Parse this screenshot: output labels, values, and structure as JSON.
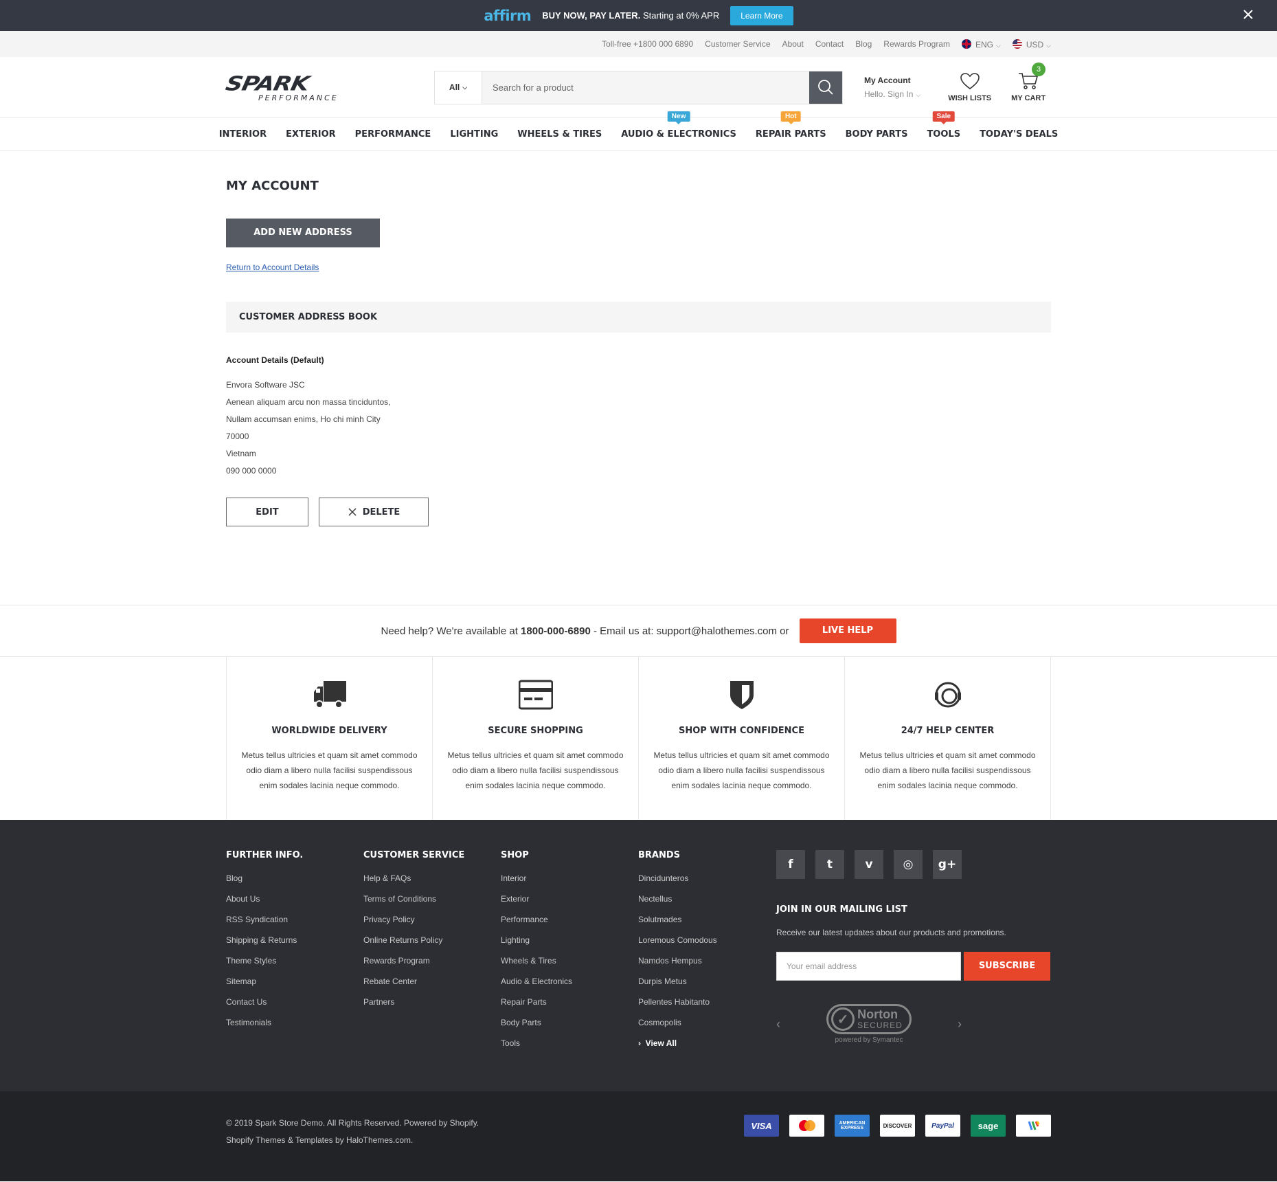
{
  "promo": {
    "brand": "affirm",
    "headline": "BUY NOW, PAY LATER.",
    "subtext": "Starting at 0% APR",
    "button": "Learn More",
    "close_icon": "close-icon"
  },
  "topbar": {
    "phone": "Toll-free +1800 000 6890",
    "links": [
      "Customer Service",
      "About",
      "Contact",
      "Blog",
      "Rewards Program"
    ],
    "language": "ENG",
    "currency": "USD"
  },
  "header": {
    "logo_main": "SPARK",
    "logo_sub": "PERFORMANCE",
    "search_category": "All",
    "search_placeholder": "Search for a product",
    "account_title": "My Account",
    "account_sub": "Hello. Sign In",
    "wishlist_label": "WISH LISTS",
    "cart_label": "MY CART",
    "cart_count": "3"
  },
  "nav": {
    "items": [
      {
        "label": "INTERIOR"
      },
      {
        "label": "EXTERIOR"
      },
      {
        "label": "PERFORMANCE"
      },
      {
        "label": "LIGHTING"
      },
      {
        "label": "WHEELS & TIRES"
      },
      {
        "label": "AUDIO & ELECTRONICS",
        "tag": "New"
      },
      {
        "label": "REPAIR PARTS",
        "tag": "Hot"
      },
      {
        "label": "BODY PARTS"
      },
      {
        "label": "TOOLS",
        "tag": "Sale"
      },
      {
        "label": "TODAY'S DEALS"
      }
    ],
    "colors": {
      "new": "#39a8d8",
      "hot": "#f6a53a",
      "sale": "#e2493b"
    }
  },
  "main": {
    "title": "MY ACCOUNT",
    "add_button": "ADD NEW ADDRESS",
    "return_link": "Return to Account Details",
    "book_title": "CUSTOMER ADDRESS BOOK",
    "address_title": "Account Details (Default)",
    "address_lines": [
      "Envora Software JSC",
      "Aenean aliquam arcu non massa tinciduntos,",
      "Nullam accumsan enims, Ho chi minh City",
      "70000",
      "Vietnam",
      "090 000 0000"
    ],
    "edit_button": "EDIT",
    "delete_button": "DELETE"
  },
  "help": {
    "text1": "Need help? We're available at",
    "phone": "1800-000-6890",
    "text2": "- Email us at: support@halothemes.com or",
    "button": "LIVE HELP"
  },
  "features": [
    {
      "icon": "truck-icon",
      "title": "WORLDWIDE DELIVERY",
      "desc": "Metus tellus ultricies et quam sit amet commodo odio diam a libero nulla facilisi suspendissous enim sodales lacinia neque commodo."
    },
    {
      "icon": "credit-card-icon",
      "title": "SECURE SHOPPING",
      "desc": "Metus tellus ultricies et quam sit amet commodo odio diam a libero nulla facilisi suspendissous enim sodales lacinia neque commodo."
    },
    {
      "icon": "shield-icon",
      "title": "SHOP WITH CONFIDENCE",
      "desc": "Metus tellus ultricies et quam sit amet commodo odio diam a libero nulla facilisi suspendissous enim sodales lacinia neque commodo."
    },
    {
      "icon": "headset-icon",
      "title": "24/7 HELP CENTER",
      "desc": "Metus tellus ultricies et quam sit amet commodo odio diam a libero nulla facilisi suspendissous enim sodales lacinia neque commodo."
    }
  ],
  "footer": {
    "columns": [
      {
        "title": "FURTHER INFO.",
        "items": [
          "Blog",
          "About Us",
          "RSS Syndication",
          "Shipping & Returns",
          "Theme Styles",
          "Sitemap",
          "Contact Us",
          "Testimonials"
        ]
      },
      {
        "title": "CUSTOMER SERVICE",
        "items": [
          "Help & FAQs",
          "Terms of Conditions",
          "Privacy Policy",
          "Online Returns Policy",
          "Rewards Program",
          "Rebate Center",
          "Partners"
        ]
      },
      {
        "title": "SHOP",
        "items": [
          "Interior",
          "Exterior",
          "Performance",
          "Lighting",
          "Wheels & Tires",
          "Audio & Electronics",
          "Repair Parts",
          "Body Parts",
          "Tools"
        ]
      },
      {
        "title": "BRANDS",
        "items": [
          "Dincidunteros",
          "Nectellus",
          "Solutmades",
          "Loremous Comodous",
          "Namdos Hempus",
          "Durpis Metus",
          "Pellentes Habitanto",
          "Cosmopolis"
        ],
        "view_all": "View All"
      }
    ],
    "social": [
      {
        "icon": "facebook-icon",
        "glyph": "f"
      },
      {
        "icon": "twitter-icon",
        "glyph": "t"
      },
      {
        "icon": "vimeo-icon",
        "glyph": "v"
      },
      {
        "icon": "instagram-icon",
        "glyph": "◎"
      },
      {
        "icon": "google-plus-icon",
        "glyph": "g+"
      }
    ],
    "mailing_title": "JOIN IN OUR MAILING LIST",
    "mailing_desc": "Receive our latest updates about our products and promotions.",
    "email_placeholder": "Your email address",
    "subscribe": "SUBSCRIBE",
    "norton_title": "Norton",
    "norton_secured": "SECURED",
    "norton_powered": "powered by Symantec"
  },
  "bottom": {
    "copyright": "© 2019 Spark Store Demo. All Rights Reserved. Powered by Shopify.",
    "credit": "Shopify Themes & Templates by HaloThemes.com.",
    "payments": [
      {
        "icon": "visa-icon",
        "label": "VISA"
      },
      {
        "icon": "mastercard-icon",
        "label": ""
      },
      {
        "icon": "amex-icon",
        "label": "AMERICAN EXPRESS"
      },
      {
        "icon": "discover-icon",
        "label": "DISCOVER"
      },
      {
        "icon": "paypal-icon",
        "label": "PayPal"
      },
      {
        "icon": "sage-icon",
        "label": "sage"
      },
      {
        "icon": "google-wallet-icon",
        "label": ""
      }
    ]
  }
}
